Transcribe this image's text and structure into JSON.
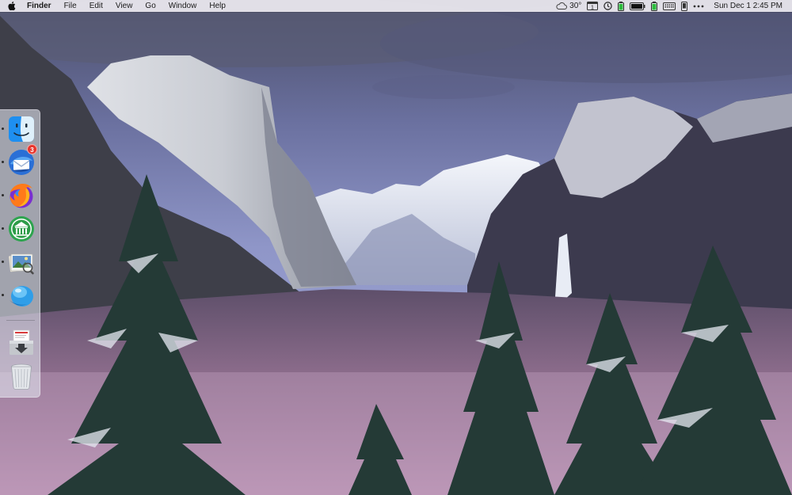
{
  "menubar": {
    "app_name": "Finder",
    "menus": [
      "File",
      "Edit",
      "View",
      "Go",
      "Window",
      "Help"
    ],
    "status": {
      "weather_temp": "30°",
      "calendar_day": "1",
      "clock": "Sun Dec 1  2:45 PM"
    }
  },
  "dock": {
    "items": [
      {
        "name": "Finder",
        "icon": "finder-icon",
        "running": true
      },
      {
        "name": "Thunderbird",
        "icon": "thunderbird-icon",
        "running": true,
        "badge": "3"
      },
      {
        "name": "Firefox",
        "icon": "firefox-icon",
        "running": true
      },
      {
        "name": "Bank App",
        "icon": "bank-icon",
        "running": true
      },
      {
        "name": "Preview",
        "icon": "preview-icon",
        "running": true
      },
      {
        "name": "Transmit",
        "icon": "transmit-icon",
        "running": true
      },
      {
        "name": "Downloads",
        "icon": "downloads-icon",
        "running": false
      },
      {
        "name": "Trash",
        "icon": "trash-icon",
        "running": false
      }
    ]
  }
}
